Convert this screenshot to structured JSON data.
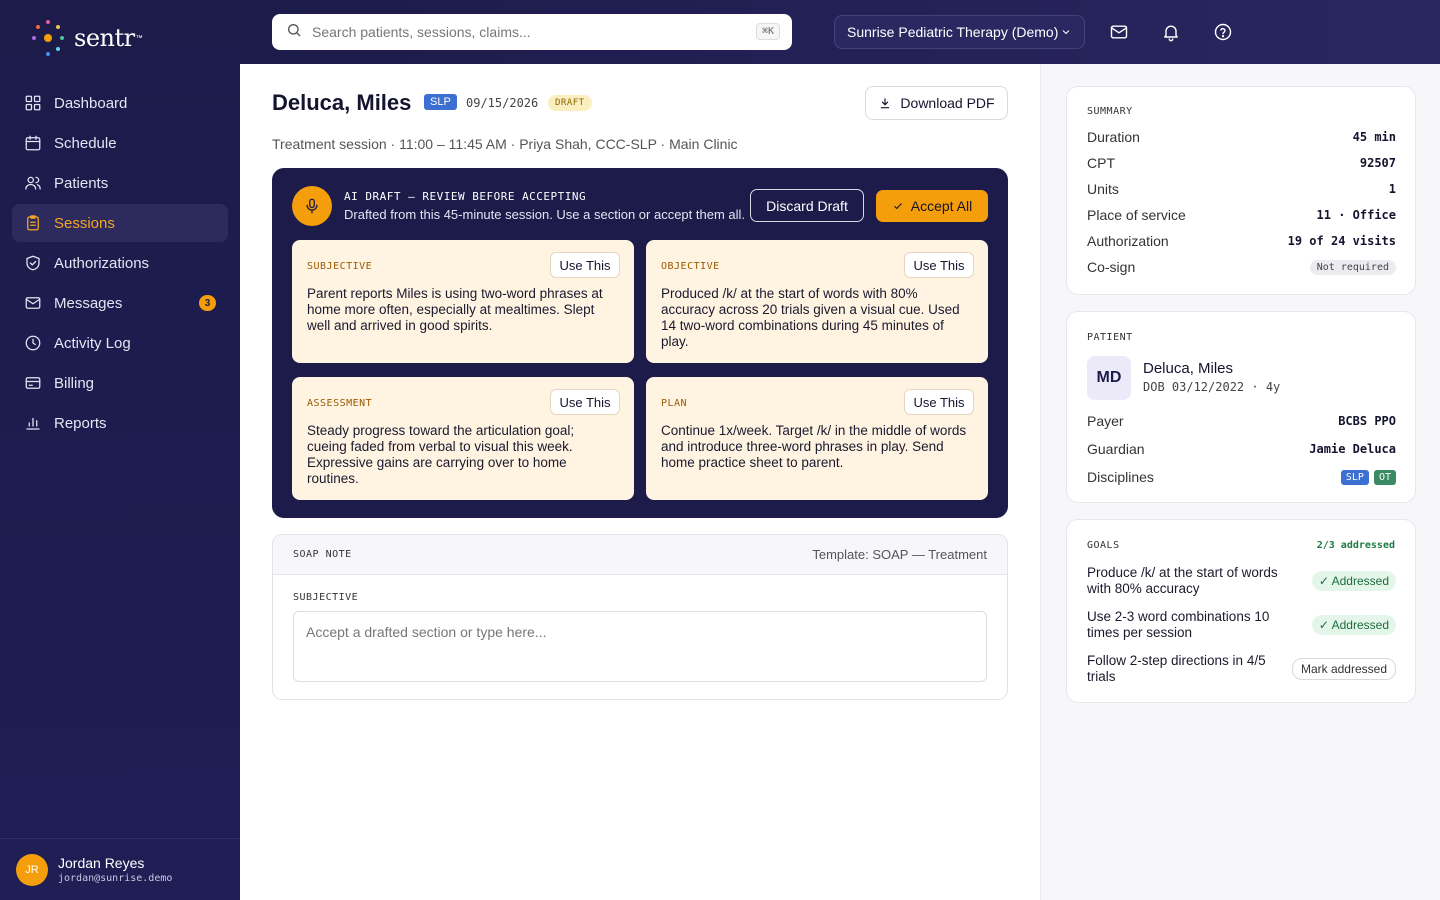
{
  "app": {
    "logo_text": "sentr",
    "logo_tm": "™"
  },
  "colors": {
    "sidebar": "#1c1b4a",
    "accent": "#f59e0b",
    "slp": "#3b6fd1",
    "ot": "#3c8a64"
  },
  "sidebar": {
    "items": [
      {
        "label": "Dashboard",
        "icon": "grid-icon"
      },
      {
        "label": "Schedule",
        "icon": "calendar-icon"
      },
      {
        "label": "Patients",
        "icon": "users-icon"
      },
      {
        "label": "Sessions",
        "icon": "clipboard-icon",
        "active": true
      },
      {
        "label": "Authorizations",
        "icon": "shield-icon"
      },
      {
        "label": "Messages",
        "icon": "mail-icon",
        "badge": "3"
      },
      {
        "label": "Activity Log",
        "icon": "clock-icon"
      },
      {
        "label": "Billing",
        "icon": "card-icon"
      },
      {
        "label": "Reports",
        "icon": "bar-chart-icon"
      }
    ],
    "user": {
      "initials": "JR",
      "name": "Jordan Reyes",
      "email": "jordan@sunrise.demo"
    }
  },
  "topbar": {
    "search_placeholder": "Search patients, sessions, claims...",
    "search_kbd": "⌘K",
    "org": "Sunrise Pediatric Therapy (Demo)"
  },
  "session": {
    "patient": "Deluca, Miles",
    "discipline": "SLP",
    "date": "09/15/2026",
    "status": "DRAFT",
    "download_label": "Download PDF",
    "meta": "Treatment session · 11:00 – 11:45 AM · Priya Shah, CCC-SLP · Main Clinic"
  },
  "ai_draft": {
    "heading": "AI DRAFT — REVIEW BEFORE ACCEPTING",
    "subheading": "Drafted from this 45-minute session. Use a section or accept them all.",
    "discard_label": "Discard Draft",
    "accept_label": "Accept All",
    "use_label": "Use This",
    "sections": [
      {
        "label": "SUBJECTIVE",
        "text": "Parent reports Miles is using two-word phrases at home more often, especially at mealtimes. Slept well and arrived in good spirits."
      },
      {
        "label": "OBJECTIVE",
        "text": "Produced /k/ at the start of words with 80% accuracy across 20 trials given a visual cue. Used 14 two-word combinations during 45 minutes of play."
      },
      {
        "label": "ASSESSMENT",
        "text": "Steady progress toward the articulation goal; cueing faded from verbal to visual this week. Expressive gains are carrying over to home routines."
      },
      {
        "label": "PLAN",
        "text": "Continue 1x/week. Target /k/ in the middle of words and introduce three-word phrases in play. Send home practice sheet to parent."
      }
    ]
  },
  "soap": {
    "title": "SOAP NOTE",
    "template": "Template: SOAP — Treatment",
    "section_label": "SUBJECTIVE",
    "placeholder": "Accept a drafted section or type here..."
  },
  "summary": {
    "title": "SUMMARY",
    "rows": [
      {
        "k": "Duration",
        "v": "45 min"
      },
      {
        "k": "CPT",
        "v": "92507"
      },
      {
        "k": "Units",
        "v": "1"
      },
      {
        "k": "Place of service",
        "v": "11 · Office"
      },
      {
        "k": "Authorization",
        "v": "19 of 24 visits"
      }
    ],
    "cosign_label": "Co-sign",
    "cosign_value": "Not required"
  },
  "patient": {
    "title": "PATIENT",
    "initials": "MD",
    "name": "Deluca, Miles",
    "dob": "DOB 03/12/2022 · 4y",
    "payer_label": "Payer",
    "payer": "BCBS PPO",
    "guardian_label": "Guardian",
    "guardian": "Jamie Deluca",
    "disciplines_label": "Disciplines",
    "disciplines": [
      "SLP",
      "OT"
    ]
  },
  "goals": {
    "title": "GOALS",
    "progress": "2/3 addressed",
    "items": [
      {
        "text": "Produce /k/ at the start of words with 80% accuracy",
        "status": "✓ Addressed",
        "addressed": true
      },
      {
        "text": "Use 2-3 word combinations 10 times per session",
        "status": "✓ Addressed",
        "addressed": true
      },
      {
        "text": "Follow 2-step directions in 4/5 trials",
        "status": "Mark addressed",
        "addressed": false
      }
    ]
  }
}
